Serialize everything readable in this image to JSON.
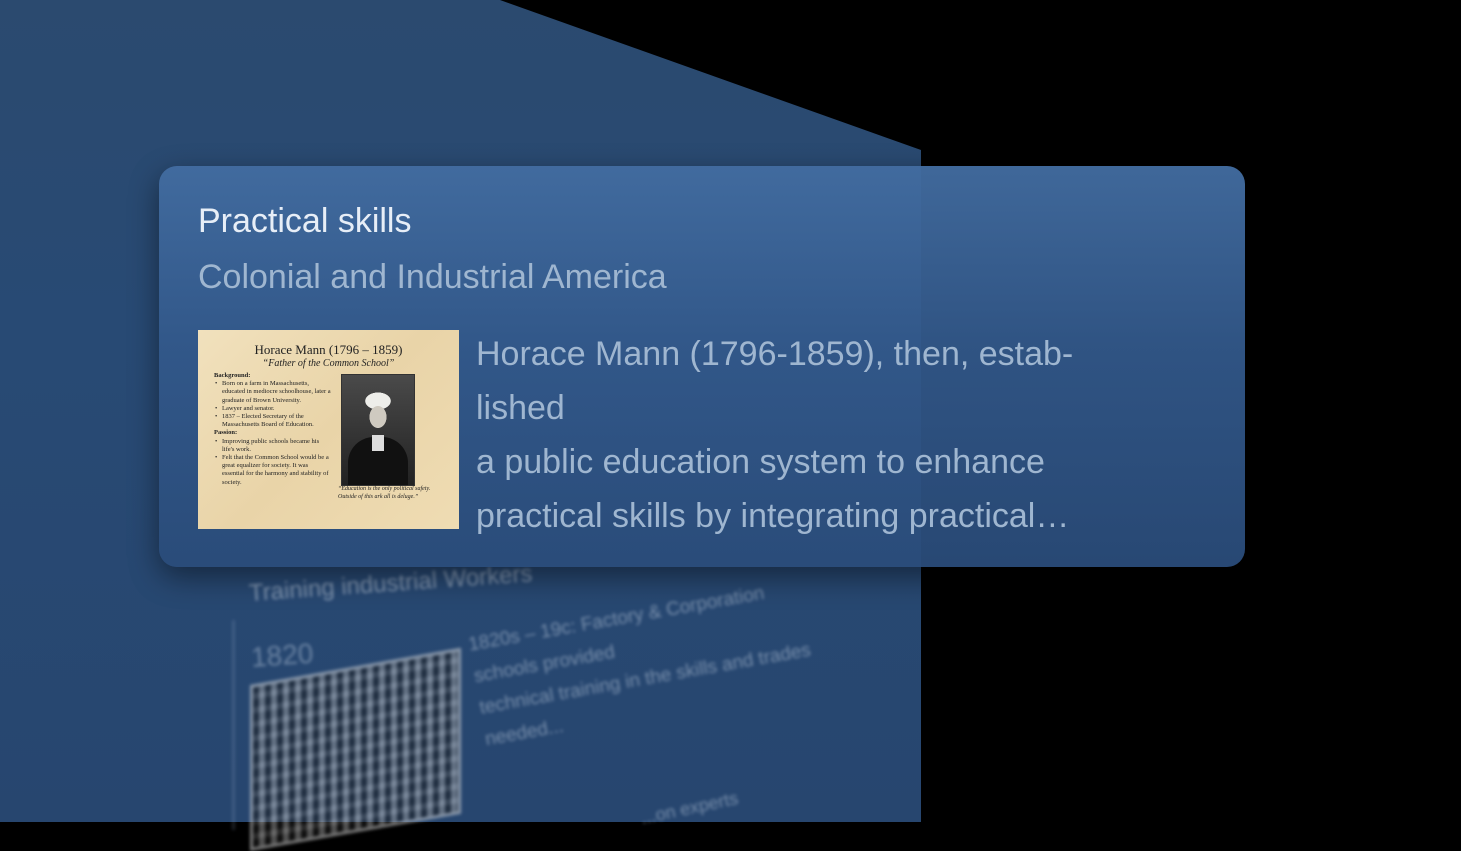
{
  "background_card": {
    "title": "Training industrial Workers",
    "year": "1820",
    "lines": [
      "1820s – 19c: Factory & Corporation",
      "schools provided",
      "technical training in the skills and trades",
      "needed..."
    ],
    "extra": "...on experts"
  },
  "card": {
    "title": "Practical skills",
    "subtitle": "Colonial and Industrial America",
    "excerpt_lines": [
      "Horace Mann (1796-1859), then, estab-",
      "lished",
      "a public education system to enhance",
      "practical skills by integrating practical…"
    ],
    "thumbnail": {
      "title": "Horace Mann (1796 – 1859)",
      "subtitle": "“Father of the Common School”",
      "background_heading": "Background:",
      "background_items": [
        "Born on a farm in Massachusetts, educated in mediocre schoolhouse, later a graduate of Brown University.",
        "Lawyer and senator.",
        "1837 – Elected Secretary of the Massachusetts Board of Education."
      ],
      "passion_heading": "Passion:",
      "passion_items": [
        "Improving public schools became his life's work.",
        "Felt that the Common School would be a great equalizer for society. It was essential for the harmony and stability of society."
      ],
      "quote": "“Education is the only political safety. Outside of this ark all is deluge.”"
    }
  },
  "colors": {
    "page_background": "#000000",
    "panel": "#284a74",
    "card_top": "#426ca0",
    "title_text": "#e7eef7",
    "muted_text": "#9fb6d0",
    "thumbnail_paper": "#ecd9af"
  }
}
